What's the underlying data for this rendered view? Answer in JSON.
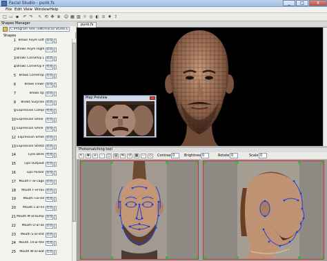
{
  "window": {
    "title": "Facial Studio - punk.fs",
    "controls": [
      "_",
      "□",
      "X"
    ]
  },
  "menu": [
    "File",
    "Edit",
    "View",
    "Window",
    "Help"
  ],
  "left_panel": {
    "title": "Shapes Manager",
    "path": "C:\\Program Files (x86)\\Facial Studio E",
    "shapes_label": "Shapes",
    "shapes": [
      {
        "index": "1",
        "name": "Brows Asym Left",
        "value": "0.0"
      },
      {
        "index": "2",
        "name": "Brows Asym Right",
        "value": "0.0"
      },
      {
        "index": "3",
        "name": "Brows CornerUp Left",
        "value": "0.0"
      },
      {
        "index": "4",
        "name": "Brows CornerUp Right",
        "value": "0.0"
      },
      {
        "index": "5",
        "name": "Brows CornerUp",
        "value": "0.0"
      },
      {
        "index": "6",
        "name": "Brows Frown",
        "value": "0.0"
      },
      {
        "index": "7",
        "name": "Brows Up",
        "value": "0.0"
      },
      {
        "index": "8",
        "name": "Brows Surprise",
        "value": "0.0"
      },
      {
        "index": "9",
        "name": "Expression Compress",
        "value": "0.0"
      },
      {
        "index": "10",
        "name": "Expression Smile Left",
        "value": "0.0"
      },
      {
        "index": "11",
        "name": "Expression Smile Right",
        "value": "0.0"
      },
      {
        "index": "12",
        "name": "Expression Smile",
        "value": "0.0"
      },
      {
        "index": "13",
        "name": "Expression Stretch",
        "value": "0.0"
      },
      {
        "index": "14",
        "name": "Eyes Blink",
        "value": "0.0"
      },
      {
        "index": "15",
        "name": "Lips Outpout",
        "value": "0.0"
      },
      {
        "index": "16",
        "name": "Lips Pucker",
        "value": "0.0"
      },
      {
        "index": "17",
        "name": "Mouth F-ar-cage",
        "value": "0.0"
      },
      {
        "index": "18",
        "name": "Mouth F-er-fav",
        "value": "0.0"
      },
      {
        "index": "19",
        "name": "Mouth I-ar-itd",
        "value": "0.0"
      },
      {
        "index": "20",
        "name": "Mouth L-ar-nil",
        "value": "0.0"
      },
      {
        "index": "21",
        "name": "Mouth M-ar-bump",
        "value": "0.0"
      },
      {
        "index": "22",
        "name": "Mouth O-ar-ok",
        "value": "0.0"
      },
      {
        "index": "23",
        "name": "Mouth S-ar-shit",
        "value": "0.0"
      },
      {
        "index": "24",
        "name": "Mouth TH-ar-the",
        "value": "0.0"
      },
      {
        "index": "25",
        "name": "Mouth W-ar-wat",
        "value": "0.0"
      }
    ]
  },
  "view": {
    "tab": "punk.fs"
  },
  "map_preview": {
    "title": "Map Preview"
  },
  "photomatching": {
    "title": "Photomatching tool",
    "contrast_label": "Contrast",
    "contrast_value": "0",
    "brightness_label": "Brightness",
    "brightness_value": "0",
    "rotate_label": "Rotate",
    "rotate_value": "0",
    "scale_label": "Scale",
    "scale_value": "0"
  },
  "colors": {
    "accent": "#3366cc",
    "landmark_line": "#1f3fd6",
    "frame_border": "#d23030",
    "handle": "#39b54a"
  }
}
